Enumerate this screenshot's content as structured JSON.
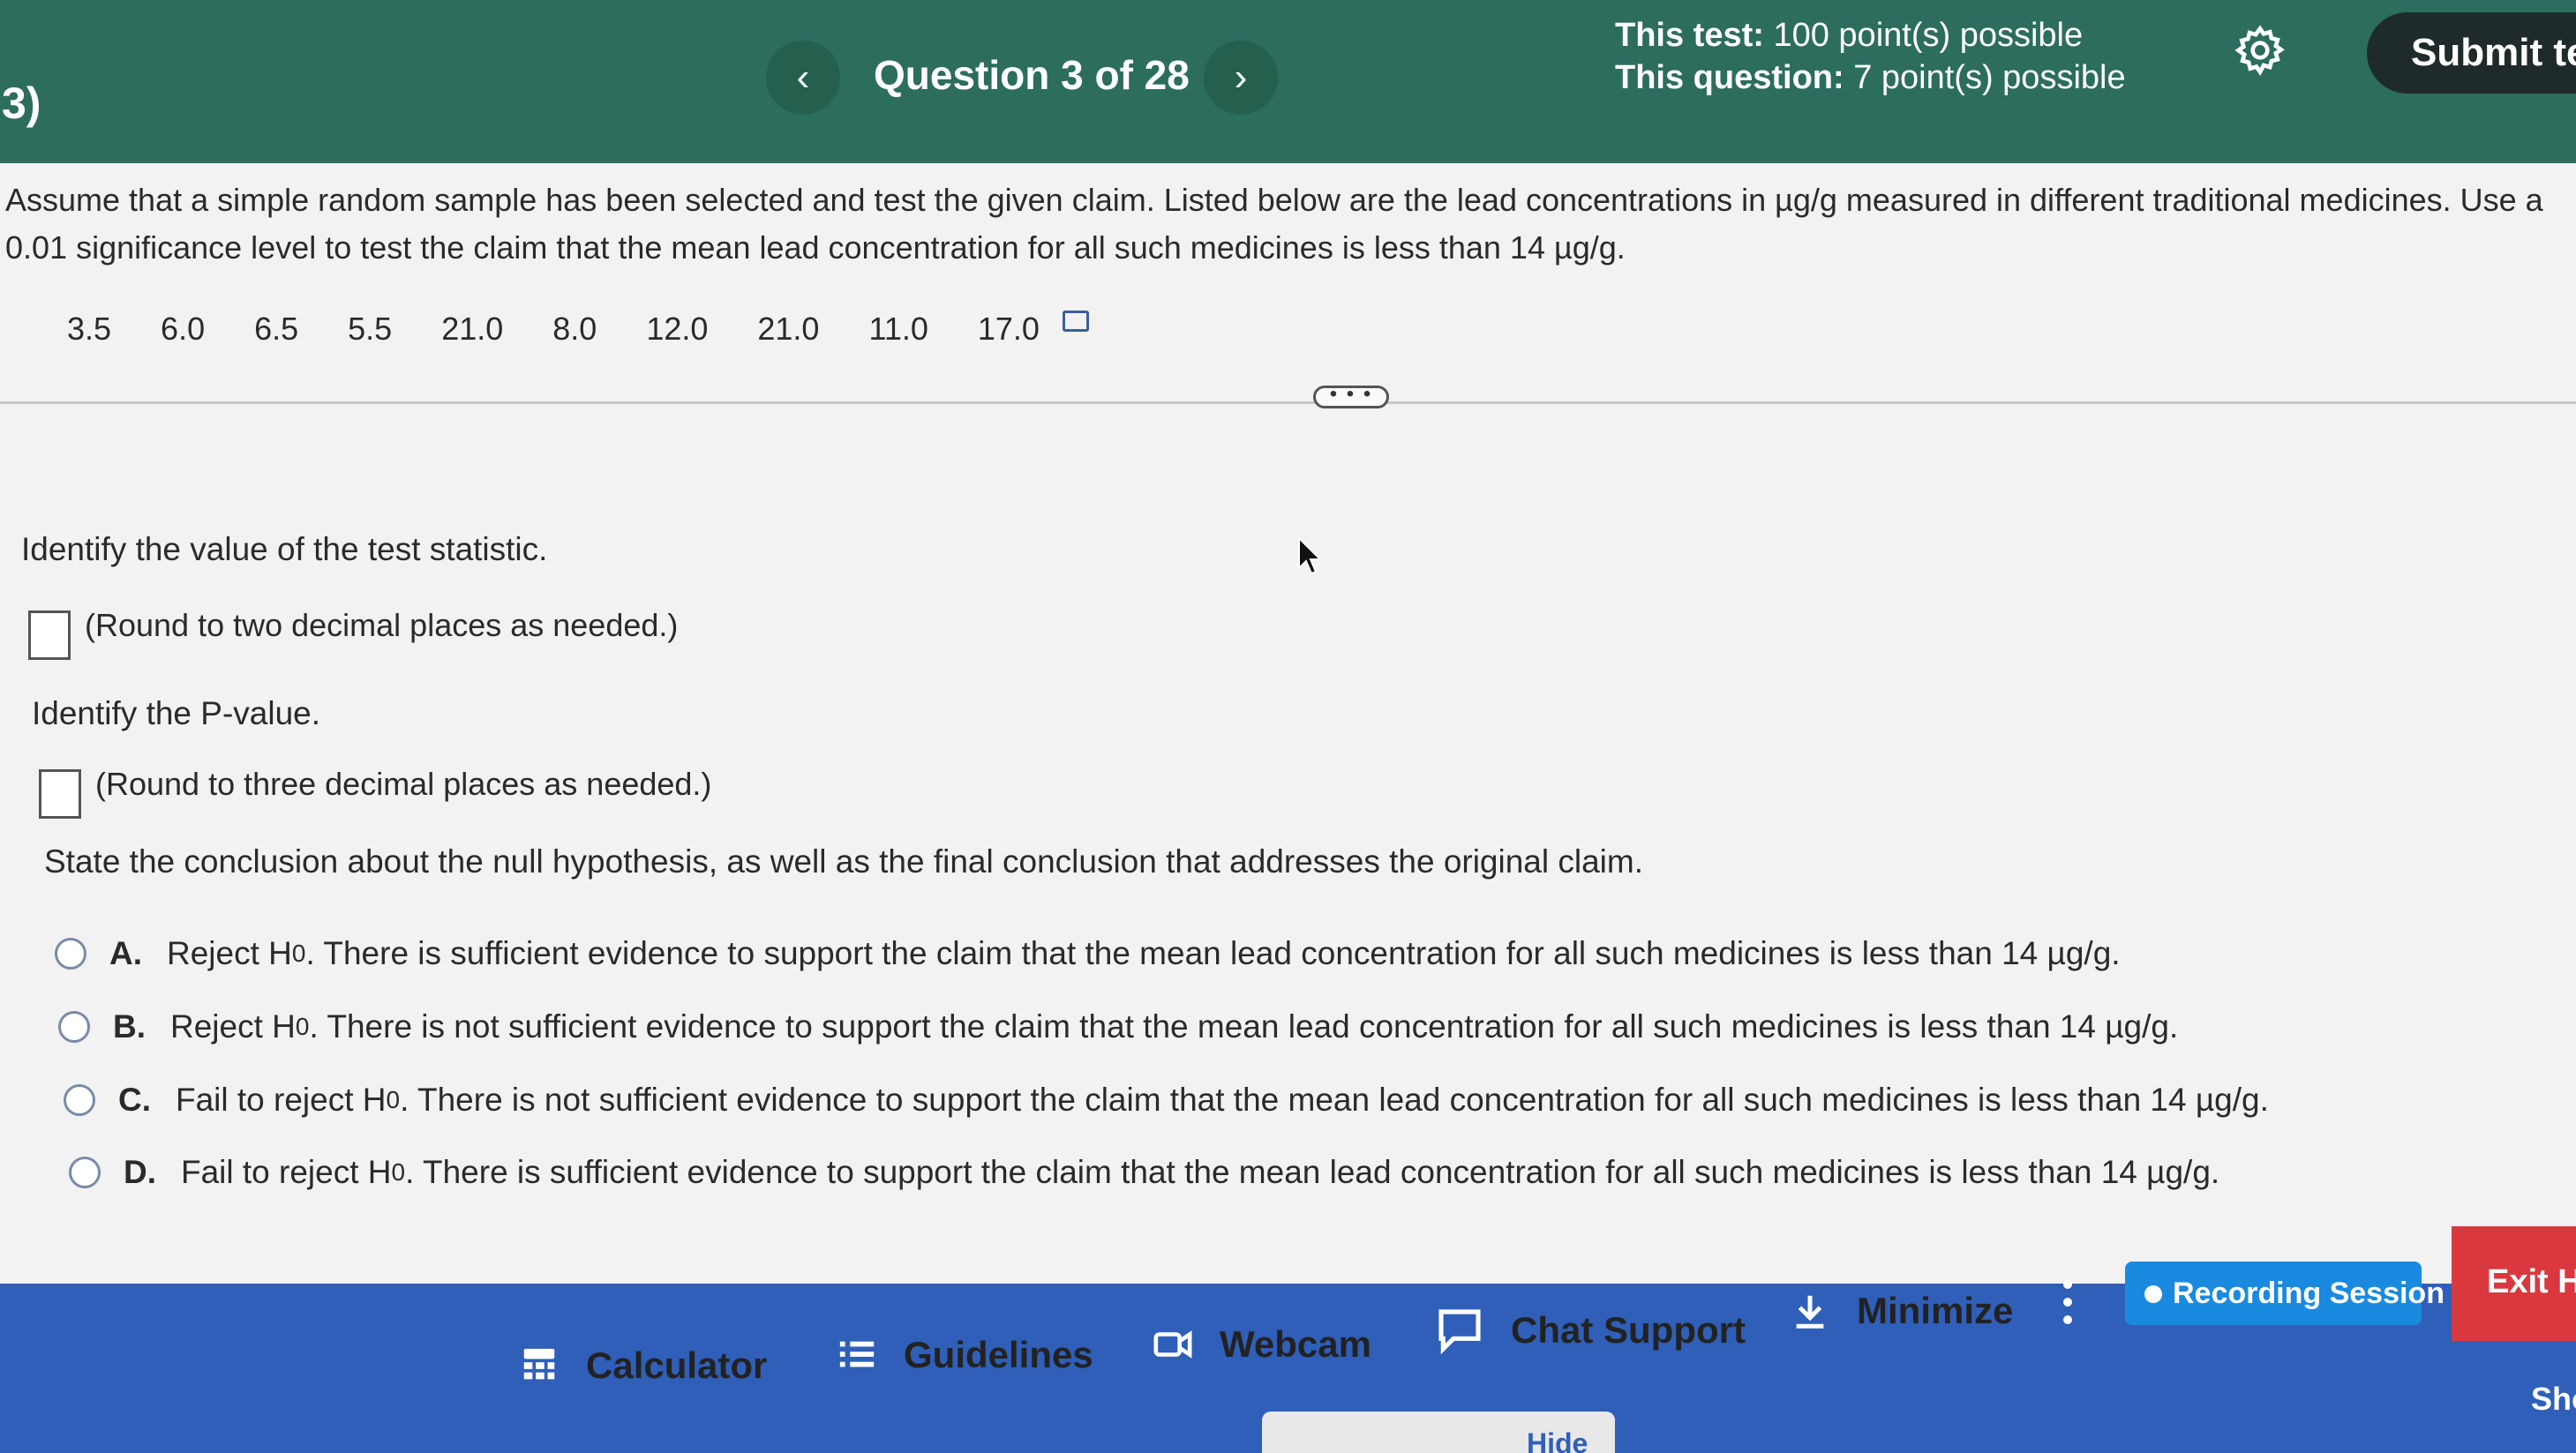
{
  "header": {
    "question_index": "3)",
    "title": "Question 3 of 28",
    "prev_icon": "‹",
    "next_icon": "›",
    "test_points_label": "This test:",
    "test_points_value": "100 point(s) possible",
    "question_points_label": "This question:",
    "question_points_value": "7 point(s) possible",
    "settings_icon": "gear-icon",
    "submit_label": "Submit te"
  },
  "question": {
    "prompt": "Assume that a simple random sample has been selected and test the given claim. Listed below are the lead concentrations in µg/g measured in different traditional medicines. Use a 0.01 significance level to test the claim that the mean lead concentration for all such medicines is less than 14 µg/g.",
    "values": [
      "3.5",
      "6.0",
      "6.5",
      "5.5",
      "21.0",
      "8.0",
      "12.0",
      "21.0",
      "11.0",
      "17.0"
    ],
    "handle_label": "• • •",
    "part1_label": "Identify the value of the test statistic.",
    "part1_hint": "(Round to two decimal places as needed.)",
    "part2_label": "Identify the P-value.",
    "part2_hint": "(Round to three decimal places as needed.)",
    "part3_label": "State the conclusion about the null hypothesis, as well as the final conclusion that addresses the original claim.",
    "options": [
      {
        "letter": "A.",
        "action": "Reject H",
        "sub": "0",
        "text": ". There is sufficient evidence to support the claim that the mean lead concentration for all such medicines is less than 14 µg/g."
      },
      {
        "letter": "B.",
        "action": "Reject H",
        "sub": "0",
        "text": ". There is not sufficient evidence to support the claim that the mean lead concentration for all such medicines is less than 14 µg/g."
      },
      {
        "letter": "C.",
        "action": "Fail to reject H",
        "sub": "0",
        "text": ". There is not sufficient evidence to support the claim that the mean lead concentration for all such medicines is less than 14 µg/g."
      },
      {
        "letter": "D.",
        "action": "Fail to reject H",
        "sub": "0",
        "text": ". There is sufficient evidence to support the claim that the mean lead concentration for all such medicines is less than 14 µg/g."
      }
    ]
  },
  "toolbar": {
    "calculator": "Calculator",
    "guidelines": "Guidelines",
    "webcam": "Webcam",
    "chat_support": "Chat Support",
    "minimize": "Minimize",
    "recording": "Recording Session",
    "exit": "Exit H",
    "hide": "Hide",
    "show": "Sho"
  },
  "colors": {
    "header_bg": "#2c6d5e",
    "toolbar_bg": "#2f5fb8",
    "recording_bg": "#1a8ae0",
    "exit_bg": "#d9393e"
  }
}
